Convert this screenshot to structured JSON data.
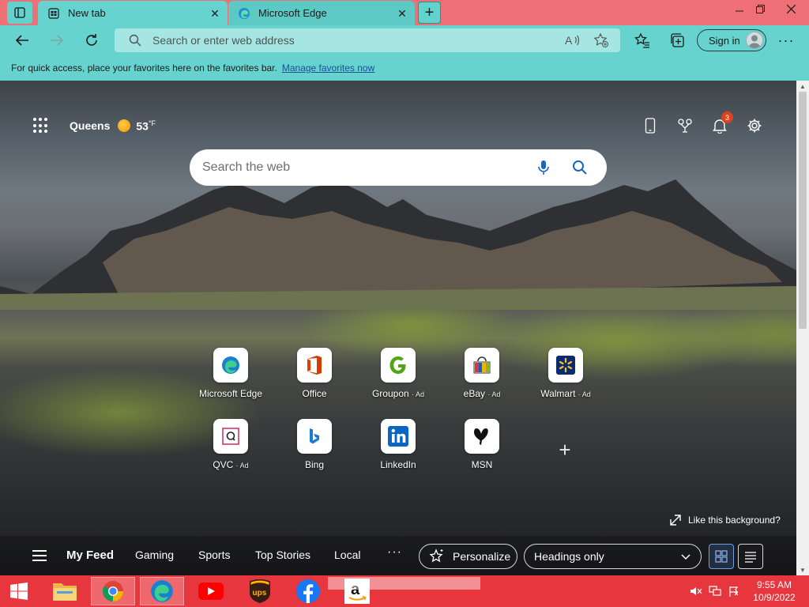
{
  "tabs": [
    {
      "label": "New tab",
      "icon": "new-tab-icon"
    },
    {
      "label": "Microsoft Edge",
      "icon": "edge-logo-icon"
    }
  ],
  "address": {
    "placeholder": "Search or enter web address",
    "signin_label": "Sign in"
  },
  "favorites_bar": {
    "message": "For quick access, place your favorites here on the favorites bar.",
    "link": "Manage favorites now"
  },
  "newtab": {
    "city": "Queens",
    "temperature": "53",
    "temperature_unit": "°F",
    "notifications_count": "3",
    "search_placeholder": "Search the web",
    "quick_links": [
      {
        "label": "Microsoft Edge",
        "ad": "",
        "icon": "edge-logo-icon"
      },
      {
        "label": "Office",
        "ad": "",
        "icon": "office-logo-icon"
      },
      {
        "label": "Groupon",
        "ad": "· Ad",
        "icon": "groupon-logo-icon"
      },
      {
        "label": "eBay",
        "ad": "· Ad",
        "icon": "ebay-logo-icon"
      },
      {
        "label": "Walmart",
        "ad": "· Ad",
        "icon": "walmart-logo-icon"
      },
      {
        "label": "QVC",
        "ad": "· Ad",
        "icon": "qvc-logo-icon"
      },
      {
        "label": "Bing",
        "ad": "",
        "icon": "bing-logo-icon"
      },
      {
        "label": "LinkedIn",
        "ad": "",
        "icon": "linkedin-logo-icon"
      },
      {
        "label": "MSN",
        "ad": "",
        "icon": "msn-logo-icon"
      }
    ],
    "like_background": "Like this background?",
    "feed": {
      "links": [
        "My Feed",
        "Gaming",
        "Sports",
        "Top Stories",
        "Local"
      ],
      "more": "···",
      "personalize": "Personalize",
      "layout_select": "Headings only"
    }
  },
  "taskbar": {
    "time": "9:55 AM",
    "date": "10/9/2022"
  },
  "colors": {
    "titlebar": "#ef6f77",
    "toolbar": "#66d3ce",
    "taskbar": "#e8363e",
    "link": "#1b4f9a"
  }
}
